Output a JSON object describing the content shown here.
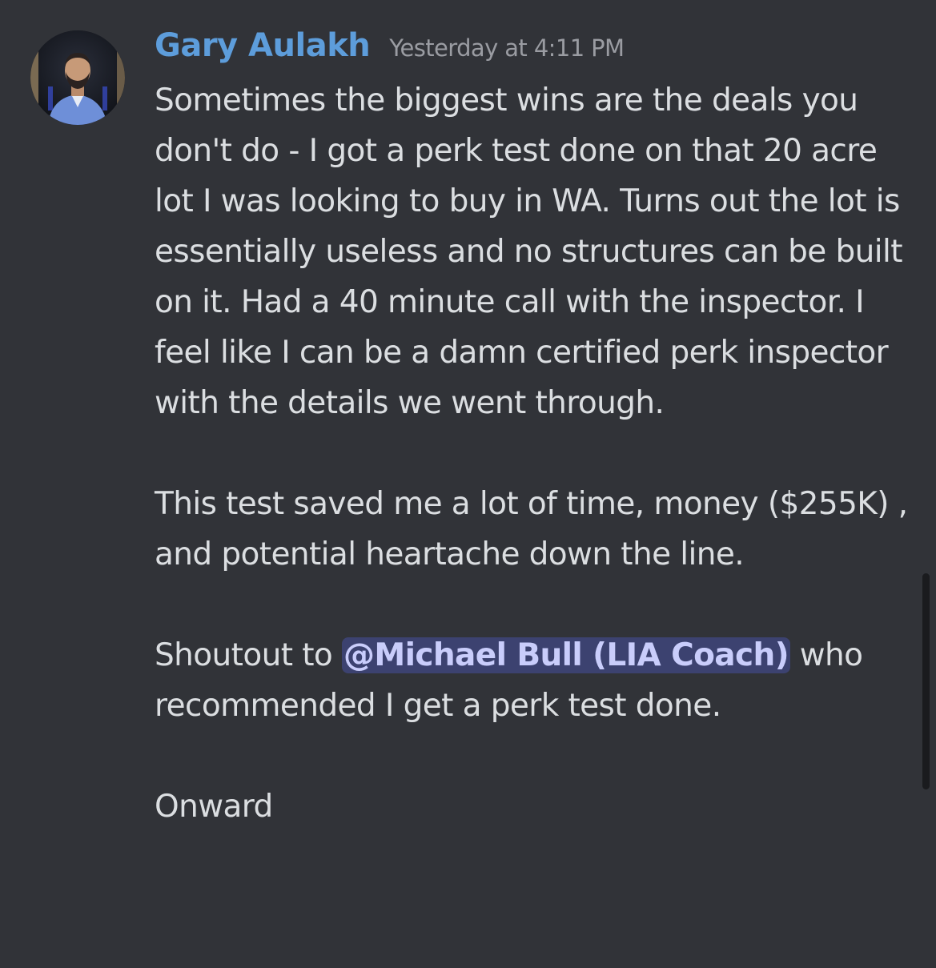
{
  "message": {
    "author": "Gary Aulakh",
    "timestamp": "Yesterday at 4:11 PM",
    "avatar_icon": "user-avatar-photo",
    "author_color": "#5d9ddb",
    "paragraph1": "Sometimes the biggest wins are the deals you don't do - I got a perk test done on that 20 acre lot I was looking to buy in WA. Turns out the lot is essentially useless and no structures can be built on it. Had a 40 minute call with the inspector. I feel like I can be a damn certified perk inspector with the details we went through.",
    "paragraph2": "This test saved me a lot of time, money ($255K) , and potential heartache down the line.",
    "paragraph3_before": "Shoutout to ",
    "mention": "@Michael Bull (LIA Coach)",
    "paragraph3_after": " who recommended I get a perk test done.",
    "paragraph4": "Onward",
    "mention_color": "#c9cdfb"
  }
}
